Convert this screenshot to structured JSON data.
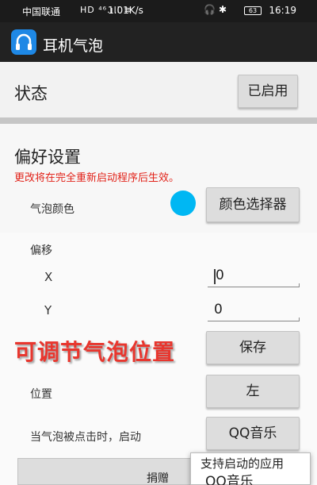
{
  "status_bar": {
    "carrier": "中国联通",
    "network_icons": "HD ⁴⁶.ıll ≋",
    "speed": "1.01K/s",
    "battery": "63",
    "time": "16:19"
  },
  "app_bar": {
    "title": "耳机气泡"
  },
  "status_section": {
    "label": "状态",
    "button": "已启用"
  },
  "prefs": {
    "title": "偏好设置",
    "warning": "更改将在完全重新启动程序后生效。",
    "bubble_color_label": "气泡颜色",
    "bubble_color": "#00b7f3",
    "color_picker_button": "颜色选择器",
    "offset_label": "偏移",
    "x_label": "X",
    "x_value": "0",
    "y_label": "Y",
    "y_value": "0",
    "save_button": "保存",
    "position_label": "位置",
    "position_button": "左",
    "launch_label": "当气泡被点击时，启动",
    "launch_button": "QQ音乐"
  },
  "overlay_caption": "可调节气泡位置",
  "donate_button": "捐赠",
  "popup": {
    "title": "支持启动的应用",
    "item": "QQ音乐"
  }
}
